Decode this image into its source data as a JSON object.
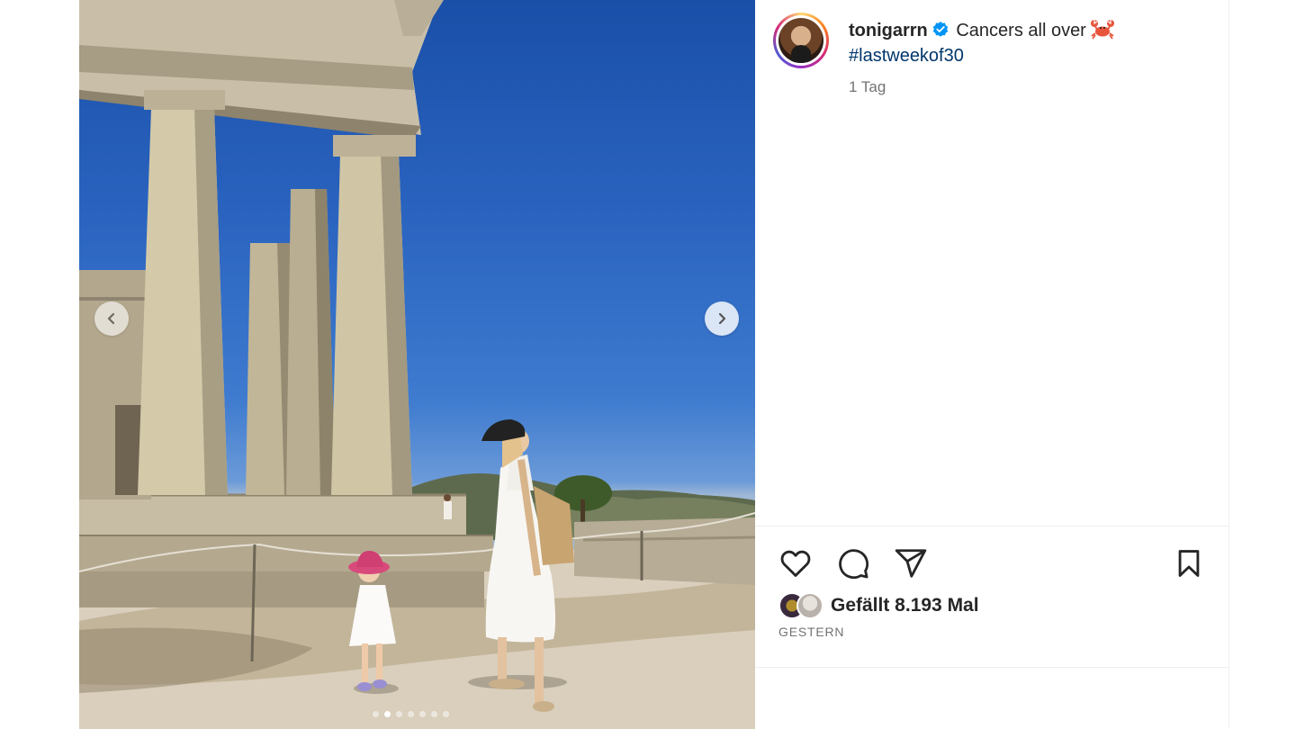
{
  "post": {
    "username": "tonigarrn",
    "caption_text": "Cancers all over",
    "hashtag": "#lastweekof30",
    "relative_time": "1 Tag",
    "likes_text": "Gefällt 8.193 Mal",
    "date_label": "GESTERN"
  },
  "carousel": {
    "slide_count": 7,
    "active_index": 1
  },
  "icons": {
    "verified": "verified-badge-icon",
    "crab": "crab-emoji-icon",
    "like": "heart-icon",
    "comment": "comment-icon",
    "share": "paper-plane-icon",
    "save": "bookmark-icon",
    "prev": "chevron-left-icon",
    "next": "chevron-right-icon"
  },
  "colors": {
    "hashtag": "#00376b",
    "verified": "#0095f6",
    "secondary_text": "#737373"
  }
}
